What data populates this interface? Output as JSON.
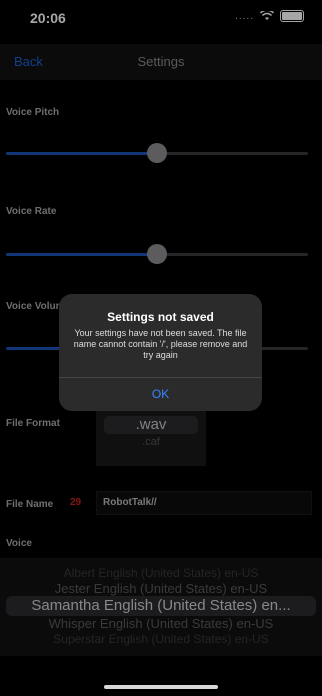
{
  "status_bar": {
    "time": "20:06",
    "signal": "....."
  },
  "nav": {
    "back_label": "Back",
    "title": "Settings"
  },
  "settings": {
    "voice_pitch": {
      "label": "Voice Pitch",
      "value_fraction": 0.5
    },
    "voice_rate": {
      "label": "Voice Rate",
      "value_fraction": 0.5
    },
    "voice_volume": {
      "label": "Voice Volume"
    }
  },
  "file_format": {
    "label": "File Format",
    "options": [
      ".wav",
      ".caf"
    ],
    "selected": ".wav"
  },
  "file_name": {
    "label": "File Name",
    "char_count": "29",
    "value": "RobotTalk//"
  },
  "voice": {
    "label": "Voice",
    "options": [
      "Albert English (United States) en-US",
      "Jester English (United States) en-US",
      "Samantha English (United States) en...",
      "Whisper English (United States) en-US",
      "Superstar English (United States) en-US"
    ],
    "selected": "Samantha English (United States) en..."
  },
  "alert": {
    "title": "Settings not saved",
    "message": "Your settings have not been saved. The file name cannot contain '/', please remove and try again",
    "ok_label": "OK"
  }
}
